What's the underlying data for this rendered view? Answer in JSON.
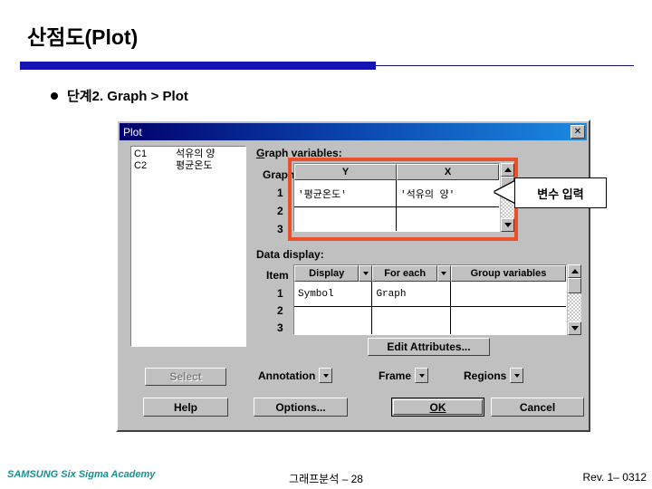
{
  "slide": {
    "title": "산점도(Plot)",
    "bullet": "단계2. Graph > Plot",
    "accent_color": "#1414b4"
  },
  "dialog": {
    "title": "Plot",
    "close_icon": "close-icon",
    "variable_list": [
      {
        "column": "C1",
        "name": "석유의 양"
      },
      {
        "column": "C2",
        "name": "평균온도"
      }
    ],
    "graph_variables": {
      "label": "Graph variables:",
      "row_label": "Graph",
      "headers": [
        "Y",
        "X"
      ],
      "rows": [
        {
          "num": "1",
          "y": "'평균온도'",
          "x": "'석유의 양'"
        },
        {
          "num": "2",
          "y": "",
          "x": ""
        },
        {
          "num": "3",
          "y": "",
          "x": ""
        }
      ]
    },
    "data_display": {
      "label": "Data display:",
      "row_label": "Item",
      "headers": [
        "Display",
        "For each",
        "Group variables"
      ],
      "rows": [
        {
          "num": "1",
          "display": "Symbol",
          "for_each": "Graph",
          "group_variables": ""
        },
        {
          "num": "2",
          "display": "",
          "for_each": "",
          "group_variables": ""
        },
        {
          "num": "3",
          "display": "",
          "for_each": "",
          "group_variables": ""
        }
      ]
    },
    "buttons": {
      "edit_attributes": "Edit Attributes...",
      "select": "Select",
      "help": "Help",
      "options": "Options...",
      "ok": "OK",
      "cancel": "Cancel"
    },
    "combos": {
      "annotation": "Annotation",
      "frame": "Frame",
      "regions": "Regions"
    }
  },
  "annotation": {
    "highlight_color": "#e8512a",
    "callout_text": "변수 입력"
  },
  "footer": {
    "left": "SAMSUNG Six Sigma Academy",
    "center": "그래프분석 – 28",
    "right": "Rev. 1– 0312"
  }
}
